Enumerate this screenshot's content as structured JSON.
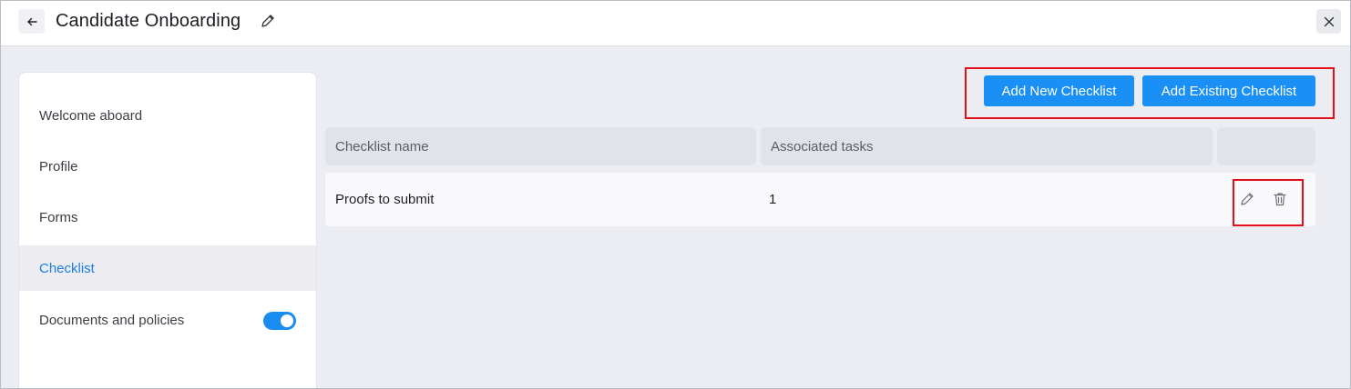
{
  "header": {
    "title": "Candidate Onboarding",
    "back_icon": "arrow-left-icon",
    "edit_icon": "pencil-icon",
    "close_icon": "close-icon"
  },
  "sidebar": {
    "items": [
      {
        "label": "Welcome aboard"
      },
      {
        "label": "Profile"
      },
      {
        "label": "Forms"
      },
      {
        "label": "Checklist",
        "active": true
      },
      {
        "label": "Documents and policies",
        "toggle_on": true
      }
    ]
  },
  "toolbar": {
    "add_new_label": "Add New Checklist",
    "add_existing_label": "Add Existing Checklist"
  },
  "table": {
    "columns": [
      "Checklist name",
      "Associated tasks",
      ""
    ],
    "rows": [
      {
        "name": "Proofs to submit",
        "tasks": "1",
        "actions": [
          "pencil-icon",
          "trash-icon"
        ]
      }
    ]
  },
  "colors": {
    "accent": "#1a8ff5",
    "highlight": "#e3101c",
    "active_text": "#1a7fe0"
  }
}
